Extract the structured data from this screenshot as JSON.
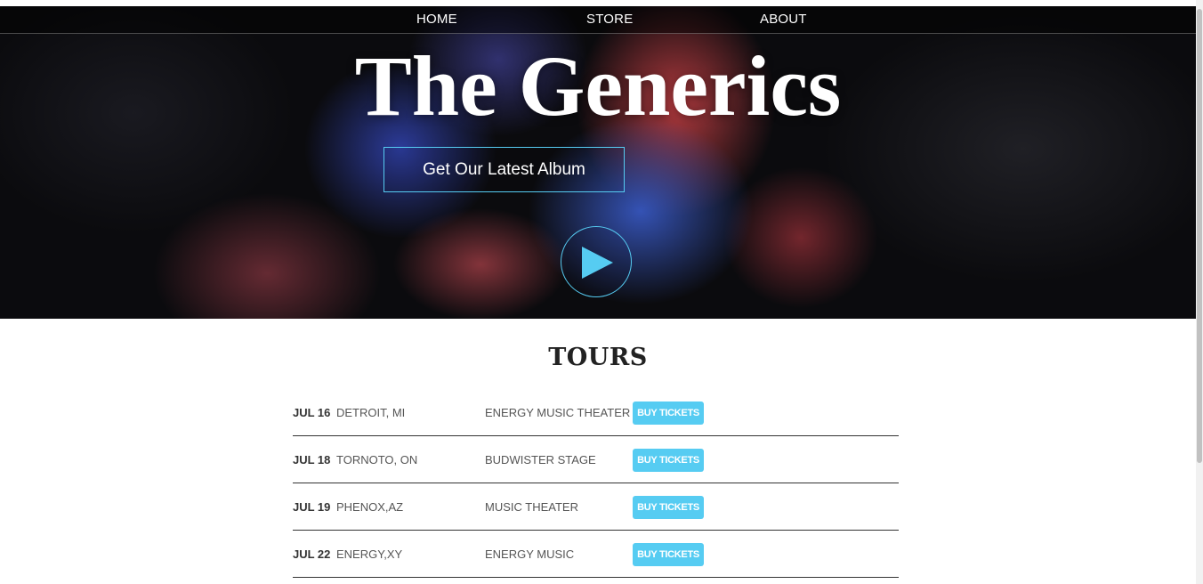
{
  "nav": {
    "home": "HOME",
    "store": "STORE",
    "about": "ABOUT"
  },
  "hero": {
    "title": "The Generics",
    "album_button": "Get Our Latest Album",
    "play_icon": "play-icon"
  },
  "tours": {
    "title": "TOURS",
    "rows": [
      {
        "date": "JUL 16",
        "city": "DETROIT, MI",
        "venue": "ENERGY MUSIC THEATER",
        "button": "BUY TICKETS"
      },
      {
        "date": "JUL 18",
        "city": "TORNOTO, ON",
        "venue": "BUDWISTER STAGE",
        "button": "BUY TICKETS"
      },
      {
        "date": "JUL 19",
        "city": "PHENOX,AZ",
        "venue": "MUSIC THEATER",
        "button": "BUY TICKETS"
      },
      {
        "date": "JUL 22",
        "city": "ENERGY,XY",
        "venue": "ENERGY MUSIC",
        "button": "BUY TICKETS"
      }
    ]
  },
  "colors": {
    "accent": "#56ccf2",
    "hero_bg": "#0b0b0e",
    "text_dark": "#333333"
  }
}
